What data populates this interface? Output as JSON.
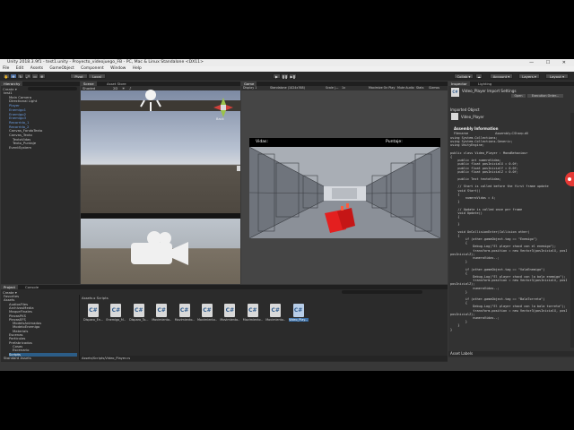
{
  "window": {
    "title": "Unity 2018.3.9f1 - test1.unity - Proyecto_videojuego_FB - PC, Mac & Linux Standalone <DX11>",
    "controls": "— ☐ ✕"
  },
  "menu": [
    "File",
    "Edit",
    "Assets",
    "GameObject",
    "Component",
    "Window",
    "Help"
  ],
  "toolbar": {
    "pivot": "Pivot",
    "local": "Local",
    "collab": "Collab ▾",
    "account": "Account ▾",
    "layers": "Layers ▾",
    "layout": "Layout ▾"
  },
  "hierarchy": {
    "tab": "Hierarchy",
    "create": "Create ▾",
    "items": [
      {
        "label": "test1",
        "cls": ""
      },
      {
        "label": "Main Camera",
        "cls": ""
      },
      {
        "label": "Directional Light",
        "cls": ""
      },
      {
        "label": "Player",
        "cls": "blue"
      },
      {
        "label": "Enemigo1",
        "cls": "blue"
      },
      {
        "label": "Enemigo2",
        "cls": "blue"
      },
      {
        "label": "Enemigo3",
        "cls": "blue"
      },
      {
        "label": "Recorrido_1",
        "cls": "blue"
      },
      {
        "label": "Recorrido_2",
        "cls": "blue"
      },
      {
        "label": "Canvas_FondoTexto",
        "cls": ""
      },
      {
        "label": "Canvas_Texto",
        "cls": ""
      },
      {
        "label": "TextoVidas",
        "cls": ""
      },
      {
        "label": "Texto_Puntaje",
        "cls": ""
      },
      {
        "label": "EventSystem",
        "cls": ""
      }
    ]
  },
  "scene": {
    "tabs": [
      "Scene",
      "Asset Store"
    ],
    "shaded": "Shaded",
    "mode": "2D",
    "persp": "Back"
  },
  "game": {
    "tab": "Game",
    "display": "Display 1",
    "aspect": "Standalone (1024x768)",
    "scale": "Scale",
    "scale_value": "1x",
    "options": [
      "Maximize On Play",
      "Mute Audio",
      "Stats",
      "Gizmos"
    ],
    "hud_vidas": "Vidas:",
    "hud_puntaje": "Puntaje:"
  },
  "inspector": {
    "tab": "Inspector",
    "lighting": "Lighting",
    "asset_title": "Video_Player Import Settings",
    "open": "Open",
    "execution_order": "Execution Order...",
    "imported_object": "Imported Object",
    "script_name": "Video_Player",
    "assembly_heading": "Assembly Information",
    "filename_label": "Filename",
    "filename_value": "Assembly-CSharp.dll",
    "asset_labels": "Asset Labels",
    "code": [
      "using System.Collections;",
      "using System.Collections.Generic;",
      "using UnityEngine;",
      "",
      "public class Video_Player : MonoBehaviour",
      "{",
      "    public int numeroVidas;",
      "    public float posInicialX = 0.0f;",
      "    public float posInicialY = 0.0f;",
      "    public float posInicialZ = 0.0f;",
      "",
      "    public Text textoVidas;",
      "",
      "    // Start is called before the first frame update",
      "    void Start()",
      "    {",
      "        numeroVidas = 4;",
      "    }",
      "",
      "    // Update is called once per frame",
      "    void Update()",
      "    {",
      "",
      "    }",
      "",
      "    void OnCollisionEnter(Collision other)",
      "    {",
      "        if (other.gameObject.tag == \"Enemigo\")",
      "        {",
      "            Debug.Log(\"El player chocó con el enemigo\");",
      "            transform.position = new Vector3(posInicialX, posInicialY,",
      "posInicialZ);",
      "            numeroVidas--;",
      "        }",
      "",
      "        if (other.gameObject.tag == \"ValaEnemigo\")",
      "        {",
      "            Debug.Log(\"El player chocó con la bala enemigo\");",
      "            transform.position = new Vector3(posInicialX, posInicialY,",
      "posInicialZ);",
      "            numeroVidas--;",
      "        }",
      "",
      "        if (other.gameObject.tag == \"BalaTorreta\")",
      "        {",
      "            Debug.Log(\"El player chocó con la bala torreta\");",
      "            transform.position = new Vector3(posInicialX, posInicialY,",
      "posInicialZ);",
      "            numeroVidas--;",
      "        }",
      "    }",
      "}"
    ]
  },
  "project": {
    "tabs": [
      "Project",
      "Console"
    ],
    "create": "Create ▾",
    "tree": [
      {
        "label": "Favorites",
        "cls": ""
      },
      {
        "label": "Assets",
        "cls": ""
      },
      {
        "label": "AudiosFiles",
        "cls": ""
      },
      {
        "label": "ArchivosMedia",
        "cls": ""
      },
      {
        "label": "MaqueFinales",
        "cls": ""
      },
      {
        "label": "PiezasPKS",
        "cls": ""
      },
      {
        "label": "PiezasEFS",
        "cls": ""
      },
      {
        "label": "ModelsAnimados",
        "cls": ""
      },
      {
        "label": "ModeloEnemigo",
        "cls": ""
      },
      {
        "label": "Materials",
        "cls": ""
      },
      {
        "label": "Escenas",
        "cls": ""
      },
      {
        "label": "Particulas",
        "cls": ""
      },
      {
        "label": "Prefabricados",
        "cls": ""
      },
      {
        "label": "Cosas",
        "cls": ""
      },
      {
        "label": "Escenario",
        "cls": ""
      },
      {
        "label": "Scripts",
        "cls": "hl"
      },
      {
        "label": "Standard Assets",
        "cls": ""
      }
    ],
    "breadcrumb": "Assets ▸ Scripts",
    "assets": [
      {
        "label": "Disparo_En...",
        "sel": false
      },
      {
        "label": "Enemigo_M...",
        "sel": false
      },
      {
        "label": "Disparo_To...",
        "sel": false
      },
      {
        "label": "Movimiento...",
        "sel": false
      },
      {
        "label": "Movimiento...",
        "sel": false
      },
      {
        "label": "Movimiento...",
        "sel": false
      },
      {
        "label": "Movimiento...",
        "sel": false
      },
      {
        "label": "Movimiento...",
        "sel": false
      },
      {
        "label": "Movimiento...",
        "sel": false
      },
      {
        "label": "Video_Play...",
        "sel": true
      }
    ],
    "status_path": "Assets/Scripts/Video_Player.cs",
    "icon_glyph": "C#"
  },
  "colors": {
    "record_button": "#e53935",
    "selection": "#3a6ea5",
    "hierarchy_blue": "#6b9ce0"
  }
}
